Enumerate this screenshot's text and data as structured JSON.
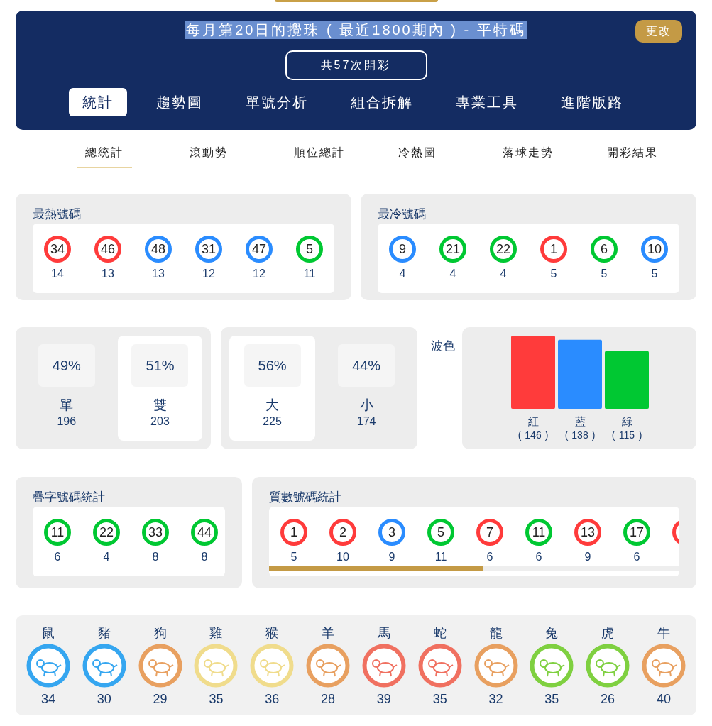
{
  "header": {
    "title": "每月第20日的攪珠 ( 最近1800期內 ) - 平特碼",
    "title_selected": true,
    "change_button": "更改",
    "draw_count": "共57次開彩"
  },
  "tabs": [
    {
      "label": "統計",
      "selected": true
    },
    {
      "label": "趨勢圖",
      "selected": false
    },
    {
      "label": "單號分析",
      "selected": false
    },
    {
      "label": "組合拆解",
      "selected": false
    },
    {
      "label": "專業工具",
      "selected": false
    },
    {
      "label": "進階版路",
      "selected": false
    }
  ],
  "subtabs": [
    {
      "label": "總統計",
      "selected": true
    },
    {
      "label": "滾動勢",
      "selected": false
    },
    {
      "label": "順位總計",
      "selected": false
    },
    {
      "label": "冷熱圖",
      "selected": false
    },
    {
      "label": "落球走勢",
      "selected": false
    },
    {
      "label": "開彩結果",
      "selected": false
    }
  ],
  "hot": {
    "title": "最熱號碼",
    "balls": [
      {
        "number": "34",
        "count": "14",
        "color": "#ff3b3b"
      },
      {
        "number": "46",
        "count": "13",
        "color": "#ff3b3b"
      },
      {
        "number": "48",
        "count": "13",
        "color": "#2a8cff"
      },
      {
        "number": "31",
        "count": "12",
        "color": "#2a8cff"
      },
      {
        "number": "47",
        "count": "12",
        "color": "#2a8cff"
      },
      {
        "number": "5",
        "count": "11",
        "color": "#00c832"
      }
    ]
  },
  "cold": {
    "title": "最冷號碼",
    "balls": [
      {
        "number": "9",
        "count": "4",
        "color": "#2a8cff"
      },
      {
        "number": "21",
        "count": "4",
        "color": "#00c832"
      },
      {
        "number": "22",
        "count": "4",
        "color": "#00c832"
      },
      {
        "number": "1",
        "count": "5",
        "color": "#ff3b3b"
      },
      {
        "number": "6",
        "count": "5",
        "color": "#00c832"
      },
      {
        "number": "10",
        "count": "5",
        "color": "#2a8cff"
      }
    ]
  },
  "odd_even": [
    {
      "percent": "49%",
      "label": "單",
      "count": "196",
      "selected": false
    },
    {
      "percent": "51%",
      "label": "雙",
      "count": "203",
      "selected": true
    }
  ],
  "big_small": [
    {
      "percent": "56%",
      "label": "大",
      "count": "225",
      "selected": true
    },
    {
      "percent": "44%",
      "label": "小",
      "count": "174",
      "selected": false
    }
  ],
  "wave": {
    "chart_data": {
      "type": "bar",
      "categories": [
        "紅",
        "藍",
        "綠"
      ],
      "colors": [
        "#ff3b3b",
        "#2a8cff",
        "#00c832"
      ],
      "series": [
        {
          "name": "波色",
          "values": [
            146,
            138,
            115
          ]
        }
      ],
      "data_labels": true
    },
    "label_open": "(",
    "label_close": ")"
  },
  "repeat": {
    "title": "疊字號碼統計",
    "balls": [
      {
        "number": "11",
        "count": "6",
        "color": "#00c832"
      },
      {
        "number": "22",
        "count": "4",
        "color": "#00c832"
      },
      {
        "number": "33",
        "count": "8",
        "color": "#00c832"
      },
      {
        "number": "44",
        "count": "8",
        "color": "#00c832"
      }
    ]
  },
  "prime": {
    "title": "質數號碼統計",
    "balls": [
      {
        "number": "1",
        "count": "5",
        "color": "#ff3b3b"
      },
      {
        "number": "2",
        "count": "10",
        "color": "#ff3b3b"
      },
      {
        "number": "3",
        "count": "9",
        "color": "#2a8cff"
      },
      {
        "number": "5",
        "count": "11",
        "color": "#00c832"
      },
      {
        "number": "7",
        "count": "6",
        "color": "#ff3b3b"
      },
      {
        "number": "11",
        "count": "6",
        "color": "#00c832"
      },
      {
        "number": "13",
        "count": "9",
        "color": "#ff3b3b"
      },
      {
        "number": "17",
        "count": "6",
        "color": "#00c832"
      },
      {
        "color": "#ff3b3b"
      }
    ]
  },
  "zodiac": [
    {
      "name": "鼠",
      "count": "34",
      "color": "#35a6f0"
    },
    {
      "name": "豬",
      "count": "30",
      "color": "#35a6f0"
    },
    {
      "name": "狗",
      "count": "29",
      "color": "#e8a060"
    },
    {
      "name": "雞",
      "count": "35",
      "color": "#f0dc8c"
    },
    {
      "name": "猴",
      "count": "36",
      "color": "#f0dc8c"
    },
    {
      "name": "羊",
      "count": "28",
      "color": "#e8a060"
    },
    {
      "name": "馬",
      "count": "39",
      "color": "#f07060"
    },
    {
      "name": "蛇",
      "count": "35",
      "color": "#f07060"
    },
    {
      "name": "龍",
      "count": "32",
      "color": "#e8a060"
    },
    {
      "name": "兔",
      "count": "35",
      "color": "#7fd040"
    },
    {
      "name": "虎",
      "count": "26",
      "color": "#7fd040"
    },
    {
      "name": "牛",
      "count": "40",
      "color": "#e8a060"
    }
  ]
}
